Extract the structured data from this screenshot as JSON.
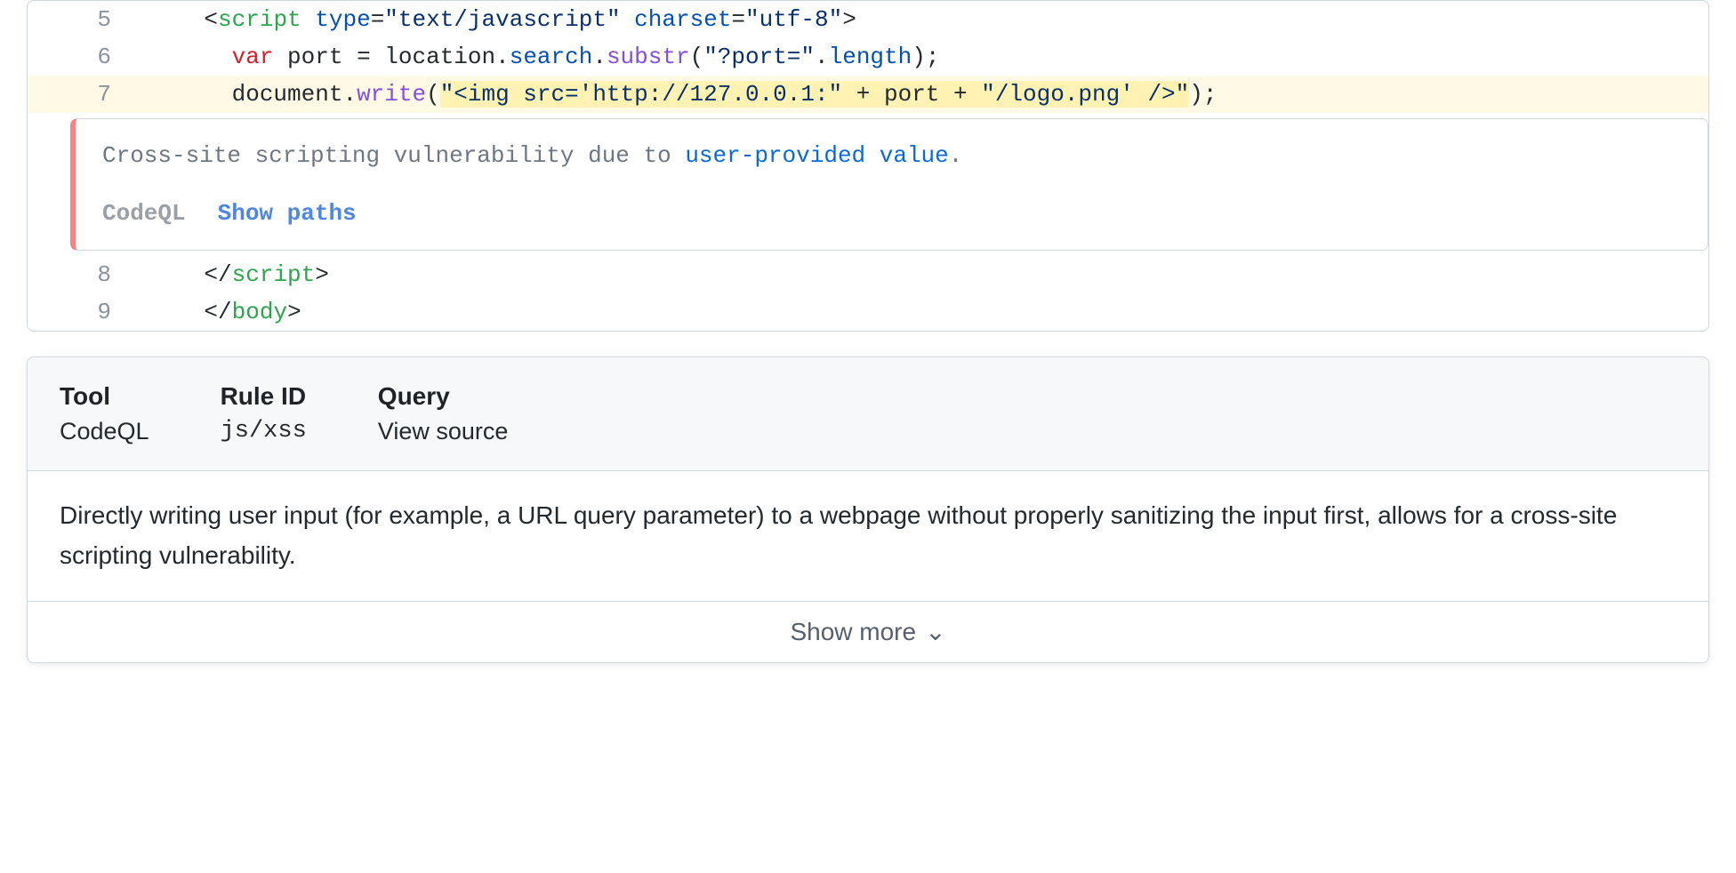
{
  "code": {
    "lines": [
      {
        "n": 5,
        "indent": "    "
      },
      {
        "n": 6,
        "indent": "      "
      },
      {
        "n": 7,
        "indent": "      ",
        "highlight": true
      },
      {
        "n": 8,
        "indent": "    "
      },
      {
        "n": 9,
        "indent": "    "
      }
    ],
    "line5": {
      "open": "<",
      "tag": "script",
      "sp1": " ",
      "attr1": "type",
      "eq1": "=",
      "val1": "\"text/javascript\"",
      "sp2": " ",
      "attr2": "charset",
      "eq2": "=",
      "val2": "\"utf-8\"",
      "close": ">"
    },
    "line6": {
      "kw": "var",
      "sp1": " ",
      "id": "port",
      "eq": " = ",
      "obj1": "location",
      "dot1": ".",
      "prop1": "search",
      "dot2": ".",
      "call": "substr",
      "open": "(",
      "arg": "\"?port=\"",
      "dot3": ".",
      "prop2": "length",
      "close": ");"
    },
    "line7": {
      "obj": "document",
      "dot": ".",
      "call": "write",
      "open": "(",
      "s1": "\"<img src='http://127.0.0.1:\"",
      "plus1": " + ",
      "var": "port",
      "plus2": " + ",
      "s2": "\"/logo.png' />\"",
      "close": ");"
    },
    "line8": {
      "open": "</",
      "tag": "script",
      "close": ">"
    },
    "line9": {
      "open": "</",
      "tag": "body",
      "close": ">"
    }
  },
  "alert": {
    "msg_pre": "Cross-site scripting vulnerability due to ",
    "msg_link": "user-provided value",
    "msg_post": ".",
    "tool": "CodeQL",
    "show_paths": "Show paths"
  },
  "details": {
    "tool_label": "Tool",
    "tool_value": "CodeQL",
    "rule_label": "Rule ID",
    "rule_value": "js/xss",
    "query_label": "Query",
    "query_value": "View source",
    "body": "Directly writing user input (for example, a URL query parameter) to a webpage without properly sanitizing the input first, allows for a cross-site scripting vulnerability.",
    "show_more": "Show more"
  }
}
